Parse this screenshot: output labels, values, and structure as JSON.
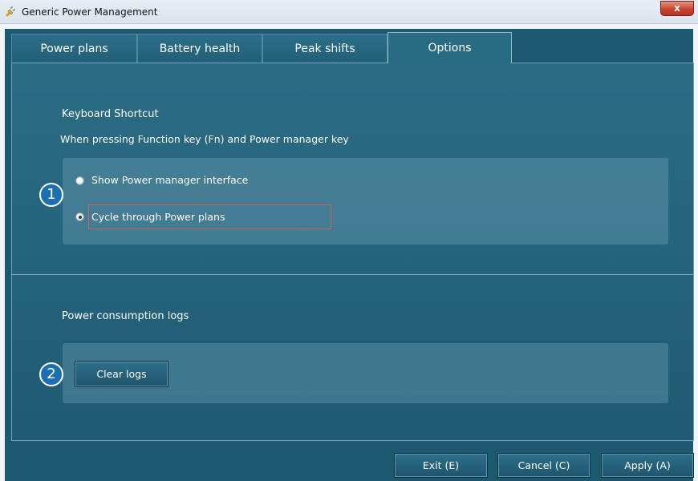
{
  "window": {
    "title": "Generic Power Management",
    "close_symbol": "x"
  },
  "tabs": [
    {
      "label": "Power plans"
    },
    {
      "label": "Battery health"
    },
    {
      "label": "Peak shifts"
    },
    {
      "label": "Options",
      "active": true
    }
  ],
  "keyboard_shortcut": {
    "heading": "Keyboard Shortcut",
    "description": "When pressing Function key (Fn) and Power manager key",
    "options": [
      {
        "label": "Show Power manager interface",
        "checked": false
      },
      {
        "label": "Cycle through Power plans",
        "checked": true
      }
    ],
    "callout": "1"
  },
  "logs": {
    "heading": "Power consumption logs",
    "clear_button": "Clear logs",
    "callout": "2"
  },
  "footer": {
    "exit": "Exit (E)",
    "cancel": "Cancel (C)",
    "apply": "Apply (A)"
  },
  "colors": {
    "panel": "#27657e",
    "callout": "#1b6fb0",
    "focus": "#c8664f"
  },
  "icons": {
    "app": "power-plug-icon",
    "close": "close-icon"
  }
}
